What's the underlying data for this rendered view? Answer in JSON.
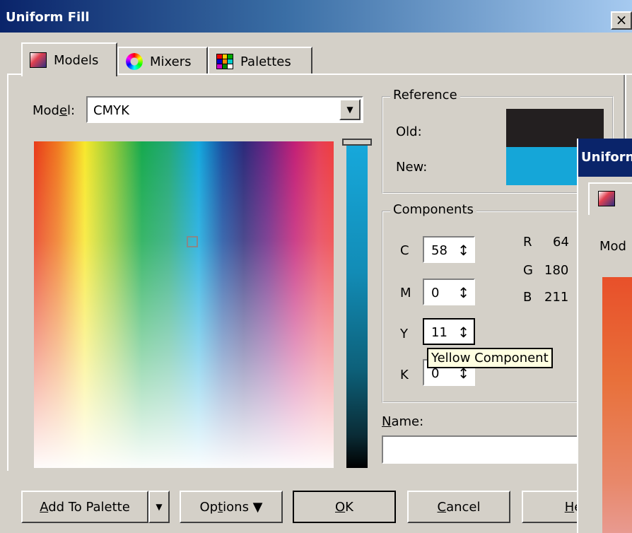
{
  "window": {
    "title": "Uniform Fill",
    "close": "×"
  },
  "tabs": [
    {
      "label": "Models",
      "icon": "color-model-icon",
      "active": true
    },
    {
      "label": "Mixers",
      "icon": "color-wheel-icon",
      "active": false
    },
    {
      "label": "Palettes",
      "icon": "palette-grid-icon",
      "active": false
    }
  ],
  "model": {
    "label": "Model:",
    "value": "CMYK"
  },
  "reference": {
    "title": "Reference",
    "old_label": "Old:",
    "new_label": "New:",
    "old_color": "#231f20",
    "new_color": "#15a6d8"
  },
  "components": {
    "title": "Components",
    "c": {
      "label": "C",
      "value": "58"
    },
    "m": {
      "label": "M",
      "value": "0"
    },
    "y": {
      "label": "Y",
      "value": "11"
    },
    "k": {
      "label": "K",
      "value": "0"
    },
    "r": {
      "label": "R",
      "value": "64"
    },
    "g": {
      "label": "G",
      "value": "180"
    },
    "b": {
      "label": "B",
      "value": "211"
    }
  },
  "tooltip": "Yellow Component",
  "name": {
    "label": "Name:",
    "value": ""
  },
  "buttons": {
    "add_to_palette": "Add To Palette",
    "options": "Options",
    "ok": "OK",
    "cancel": "Cancel",
    "help": "He"
  },
  "second_window": {
    "title": "Uniforn",
    "model_label": "Mod"
  }
}
